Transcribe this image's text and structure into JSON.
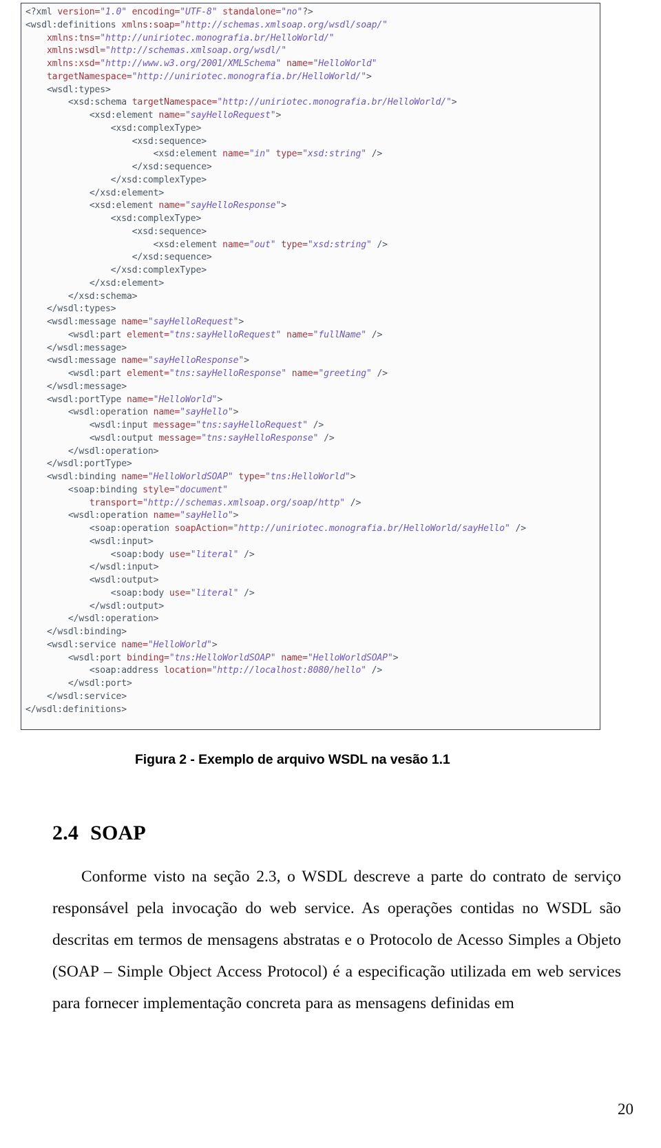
{
  "figure": {
    "name": "wsdl-code-screenshot",
    "caption": "Figura 2 - Exemplo de arquivo WSDL na vesão 1.1",
    "code_lines": [
      [
        {
          "t": "pun",
          "s": "<?xml "
        },
        {
          "t": "att",
          "s": "version="
        },
        {
          "t": "val",
          "s": "\"1.0\""
        },
        {
          "t": "att",
          "s": " encoding="
        },
        {
          "t": "val",
          "s": "\"UTF-8\""
        },
        {
          "t": "att",
          "s": " standalone="
        },
        {
          "t": "val",
          "s": "\"no\""
        },
        {
          "t": "pun",
          "s": "?>"
        }
      ],
      [
        {
          "t": "tag",
          "s": "<wsdl:definitions "
        },
        {
          "t": "att",
          "s": "xmlns:soap="
        },
        {
          "t": "val",
          "s": "\"http://schemas.xmlsoap.org/wsdl/soap/\""
        }
      ],
      [
        {
          "t": "pun",
          "s": "    "
        },
        {
          "t": "att",
          "s": "xmlns:tns="
        },
        {
          "t": "val",
          "s": "\"http://uniriotec.monografia.br/HelloWorld/\""
        }
      ],
      [
        {
          "t": "pun",
          "s": "    "
        },
        {
          "t": "att",
          "s": "xmlns:wsdl="
        },
        {
          "t": "val",
          "s": "\"http://schemas.xmlsoap.org/wsdl/\""
        }
      ],
      [
        {
          "t": "pun",
          "s": "    "
        },
        {
          "t": "att",
          "s": "xmlns:xsd="
        },
        {
          "t": "val",
          "s": "\"http://www.w3.org/2001/XMLSchema\""
        },
        {
          "t": "att",
          "s": " name="
        },
        {
          "t": "val",
          "s": "\"HelloWorld\""
        }
      ],
      [
        {
          "t": "pun",
          "s": "    "
        },
        {
          "t": "att",
          "s": "targetNamespace="
        },
        {
          "t": "val",
          "s": "\"http://uniriotec.monografia.br/HelloWorld/\""
        },
        {
          "t": "pun",
          "s": ">"
        }
      ],
      [
        {
          "t": "pun",
          "s": "    "
        },
        {
          "t": "tag",
          "s": "<wsdl:types>"
        }
      ],
      [
        {
          "t": "pun",
          "s": "        "
        },
        {
          "t": "tag",
          "s": "<xsd:schema "
        },
        {
          "t": "att",
          "s": "targetNamespace="
        },
        {
          "t": "val",
          "s": "\"http://uniriotec.monografia.br/HelloWorld/\""
        },
        {
          "t": "pun",
          "s": ">"
        }
      ],
      [
        {
          "t": "pun",
          "s": "            "
        },
        {
          "t": "tag",
          "s": "<xsd:element "
        },
        {
          "t": "att",
          "s": "name="
        },
        {
          "t": "val",
          "s": "\"sayHelloRequest\""
        },
        {
          "t": "pun",
          "s": ">"
        }
      ],
      [
        {
          "t": "pun",
          "s": "                "
        },
        {
          "t": "tag",
          "s": "<xsd:complexType>"
        }
      ],
      [
        {
          "t": "pun",
          "s": "                    "
        },
        {
          "t": "tag",
          "s": "<xsd:sequence>"
        }
      ],
      [
        {
          "t": "pun",
          "s": "                        "
        },
        {
          "t": "tag",
          "s": "<xsd:element "
        },
        {
          "t": "att",
          "s": "name="
        },
        {
          "t": "val",
          "s": "\"in\""
        },
        {
          "t": "att",
          "s": " type="
        },
        {
          "t": "val",
          "s": "\"xsd:string\""
        },
        {
          "t": "pun",
          "s": " />"
        }
      ],
      [
        {
          "t": "pun",
          "s": "                    "
        },
        {
          "t": "tag",
          "s": "</xsd:sequence>"
        }
      ],
      [
        {
          "t": "pun",
          "s": "                "
        },
        {
          "t": "tag",
          "s": "</xsd:complexType>"
        }
      ],
      [
        {
          "t": "pun",
          "s": "            "
        },
        {
          "t": "tag",
          "s": "</xsd:element>"
        }
      ],
      [
        {
          "t": "pun",
          "s": "            "
        },
        {
          "t": "tag",
          "s": "<xsd:element "
        },
        {
          "t": "att",
          "s": "name="
        },
        {
          "t": "val",
          "s": "\"sayHelloResponse\""
        },
        {
          "t": "pun",
          "s": ">"
        }
      ],
      [
        {
          "t": "pun",
          "s": "                "
        },
        {
          "t": "tag",
          "s": "<xsd:complexType>"
        }
      ],
      [
        {
          "t": "pun",
          "s": "                    "
        },
        {
          "t": "tag",
          "s": "<xsd:sequence>"
        }
      ],
      [
        {
          "t": "pun",
          "s": "                        "
        },
        {
          "t": "tag",
          "s": "<xsd:element "
        },
        {
          "t": "att",
          "s": "name="
        },
        {
          "t": "val",
          "s": "\"out\""
        },
        {
          "t": "att",
          "s": " type="
        },
        {
          "t": "val",
          "s": "\"xsd:string\""
        },
        {
          "t": "pun",
          "s": " />"
        }
      ],
      [
        {
          "t": "pun",
          "s": "                    "
        },
        {
          "t": "tag",
          "s": "</xsd:sequence>"
        }
      ],
      [
        {
          "t": "pun",
          "s": "                "
        },
        {
          "t": "tag",
          "s": "</xsd:complexType>"
        }
      ],
      [
        {
          "t": "pun",
          "s": "            "
        },
        {
          "t": "tag",
          "s": "</xsd:element>"
        }
      ],
      [
        {
          "t": "pun",
          "s": "        "
        },
        {
          "t": "tag",
          "s": "</xsd:schema>"
        }
      ],
      [
        {
          "t": "pun",
          "s": "    "
        },
        {
          "t": "tag",
          "s": "</wsdl:types>"
        }
      ],
      [
        {
          "t": "pun",
          "s": "    "
        },
        {
          "t": "tag",
          "s": "<wsdl:message "
        },
        {
          "t": "att",
          "s": "name="
        },
        {
          "t": "val",
          "s": "\"sayHelloRequest\""
        },
        {
          "t": "pun",
          "s": ">"
        }
      ],
      [
        {
          "t": "pun",
          "s": "        "
        },
        {
          "t": "tag",
          "s": "<wsdl:part "
        },
        {
          "t": "att",
          "s": "element="
        },
        {
          "t": "val",
          "s": "\"tns:sayHelloRequest\""
        },
        {
          "t": "att",
          "s": " name="
        },
        {
          "t": "val",
          "s": "\"fullName\""
        },
        {
          "t": "pun",
          "s": " />"
        }
      ],
      [
        {
          "t": "pun",
          "s": "    "
        },
        {
          "t": "tag",
          "s": "</wsdl:message>"
        }
      ],
      [
        {
          "t": "pun",
          "s": "    "
        },
        {
          "t": "tag",
          "s": "<wsdl:message "
        },
        {
          "t": "att",
          "s": "name="
        },
        {
          "t": "val",
          "s": "\"sayHelloResponse\""
        },
        {
          "t": "pun",
          "s": ">"
        }
      ],
      [
        {
          "t": "pun",
          "s": "        "
        },
        {
          "t": "tag",
          "s": "<wsdl:part "
        },
        {
          "t": "att",
          "s": "element="
        },
        {
          "t": "val",
          "s": "\"tns:sayHelloResponse\""
        },
        {
          "t": "att",
          "s": " name="
        },
        {
          "t": "val",
          "s": "\"greeting\""
        },
        {
          "t": "pun",
          "s": " />"
        }
      ],
      [
        {
          "t": "pun",
          "s": "    "
        },
        {
          "t": "tag",
          "s": "</wsdl:message>"
        }
      ],
      [
        {
          "t": "pun",
          "s": "    "
        },
        {
          "t": "tag",
          "s": "<wsdl:portType "
        },
        {
          "t": "att",
          "s": "name="
        },
        {
          "t": "val",
          "s": "\"HelloWorld\""
        },
        {
          "t": "pun",
          "s": ">"
        }
      ],
      [
        {
          "t": "pun",
          "s": "        "
        },
        {
          "t": "tag",
          "s": "<wsdl:operation "
        },
        {
          "t": "att",
          "s": "name="
        },
        {
          "t": "val",
          "s": "\"sayHello\""
        },
        {
          "t": "pun",
          "s": ">"
        }
      ],
      [
        {
          "t": "pun",
          "s": "            "
        },
        {
          "t": "tag",
          "s": "<wsdl:input "
        },
        {
          "t": "att",
          "s": "message="
        },
        {
          "t": "val",
          "s": "\"tns:sayHelloRequest\""
        },
        {
          "t": "pun",
          "s": " />"
        }
      ],
      [
        {
          "t": "pun",
          "s": "            "
        },
        {
          "t": "tag",
          "s": "<wsdl:output "
        },
        {
          "t": "att",
          "s": "message="
        },
        {
          "t": "val",
          "s": "\"tns:sayHelloResponse\""
        },
        {
          "t": "pun",
          "s": " />"
        }
      ],
      [
        {
          "t": "pun",
          "s": "        "
        },
        {
          "t": "tag",
          "s": "</wsdl:operation>"
        }
      ],
      [
        {
          "t": "pun",
          "s": "    "
        },
        {
          "t": "tag",
          "s": "</wsdl:portType>"
        }
      ],
      [
        {
          "t": "pun",
          "s": "    "
        },
        {
          "t": "tag",
          "s": "<wsdl:binding "
        },
        {
          "t": "att",
          "s": "name="
        },
        {
          "t": "val",
          "s": "\"HelloWorldSOAP\""
        },
        {
          "t": "att",
          "s": " type="
        },
        {
          "t": "val",
          "s": "\"tns:HelloWorld\""
        },
        {
          "t": "pun",
          "s": ">"
        }
      ],
      [
        {
          "t": "pun",
          "s": "        "
        },
        {
          "t": "tag",
          "s": "<soap:binding "
        },
        {
          "t": "att",
          "s": "style="
        },
        {
          "t": "val",
          "s": "\"document\""
        }
      ],
      [
        {
          "t": "pun",
          "s": "            "
        },
        {
          "t": "att",
          "s": "transport="
        },
        {
          "t": "val",
          "s": "\"http://schemas.xmlsoap.org/soap/http\""
        },
        {
          "t": "pun",
          "s": " />"
        }
      ],
      [
        {
          "t": "pun",
          "s": "        "
        },
        {
          "t": "tag",
          "s": "<wsdl:operation "
        },
        {
          "t": "att",
          "s": "name="
        },
        {
          "t": "val",
          "s": "\"sayHello\""
        },
        {
          "t": "pun",
          "s": ">"
        }
      ],
      [
        {
          "t": "pun",
          "s": "            "
        },
        {
          "t": "tag",
          "s": "<soap:operation "
        },
        {
          "t": "att",
          "s": "soapAction="
        },
        {
          "t": "val",
          "s": "\"http://uniriotec.monografia.br/HelloWorld/sayHello\""
        },
        {
          "t": "pun",
          "s": " />"
        }
      ],
      [
        {
          "t": "pun",
          "s": "            "
        },
        {
          "t": "tag",
          "s": "<wsdl:input>"
        }
      ],
      [
        {
          "t": "pun",
          "s": "                "
        },
        {
          "t": "tag",
          "s": "<soap:body "
        },
        {
          "t": "att",
          "s": "use="
        },
        {
          "t": "val",
          "s": "\"literal\""
        },
        {
          "t": "pun",
          "s": " />"
        }
      ],
      [
        {
          "t": "pun",
          "s": "            "
        },
        {
          "t": "tag",
          "s": "</wsdl:input>"
        }
      ],
      [
        {
          "t": "pun",
          "s": "            "
        },
        {
          "t": "tag",
          "s": "<wsdl:output>"
        }
      ],
      [
        {
          "t": "pun",
          "s": "                "
        },
        {
          "t": "tag",
          "s": "<soap:body "
        },
        {
          "t": "att",
          "s": "use="
        },
        {
          "t": "val",
          "s": "\"literal\""
        },
        {
          "t": "pun",
          "s": " />"
        }
      ],
      [
        {
          "t": "pun",
          "s": "            "
        },
        {
          "t": "tag",
          "s": "</wsdl:output>"
        }
      ],
      [
        {
          "t": "pun",
          "s": "        "
        },
        {
          "t": "tag",
          "s": "</wsdl:operation>"
        }
      ],
      [
        {
          "t": "pun",
          "s": "    "
        },
        {
          "t": "tag",
          "s": "</wsdl:binding>"
        }
      ],
      [
        {
          "t": "pun",
          "s": "    "
        },
        {
          "t": "tag",
          "s": "<wsdl:service "
        },
        {
          "t": "att",
          "s": "name="
        },
        {
          "t": "val",
          "s": "\"HelloWorld\""
        },
        {
          "t": "pun",
          "s": ">"
        }
      ],
      [
        {
          "t": "pun",
          "s": "        "
        },
        {
          "t": "tag",
          "s": "<wsdl:port "
        },
        {
          "t": "att",
          "s": "binding="
        },
        {
          "t": "val",
          "s": "\"tns:HelloWorldSOAP\""
        },
        {
          "t": "att",
          "s": " name="
        },
        {
          "t": "val",
          "s": "\"HelloWorldSOAP\""
        },
        {
          "t": "pun",
          "s": ">"
        }
      ],
      [
        {
          "t": "pun",
          "s": "            "
        },
        {
          "t": "tag",
          "s": "<soap:address "
        },
        {
          "t": "att",
          "s": "location="
        },
        {
          "t": "val",
          "s": "\"http://localhost:8080/hello\""
        },
        {
          "t": "pun",
          "s": " />"
        }
      ],
      [
        {
          "t": "pun",
          "s": "        "
        },
        {
          "t": "tag",
          "s": "</wsdl:port>"
        }
      ],
      [
        {
          "t": "pun",
          "s": "    "
        },
        {
          "t": "tag",
          "s": "</wsdl:service>"
        }
      ],
      [
        {
          "t": "tag",
          "s": "</wsdl:definitions>"
        }
      ]
    ]
  },
  "section": {
    "number": "2.4",
    "title": "SOAP"
  },
  "body": {
    "paragraph": "Conforme visto na seção 2.3, o WSDL descreve a parte do contrato de serviço responsável pela invocação do web service. As operações contidas no WSDL são descritas em termos de mensagens abstratas e o Protocolo de Acesso Simples a Objeto (SOAP – Simple Object Access Protocol) é a especificação utilizada em web services para fornecer implementação concreta para as mensagens definidas em"
  },
  "page": {
    "number": "20"
  },
  "colors": {
    "tag": "#4a5560",
    "attribute": "#9c3640",
    "value": "#6d56b8",
    "code_background": "#fbfbfb",
    "code_border": "#3a3f45",
    "text": "#000000"
  }
}
